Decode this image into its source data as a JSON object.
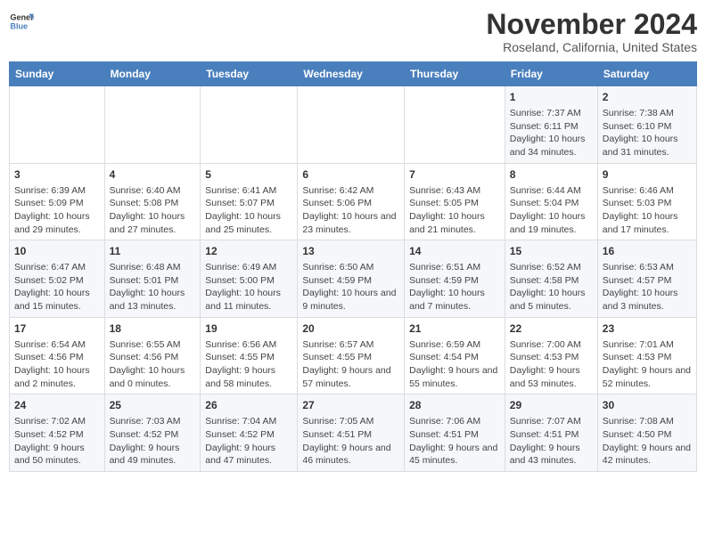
{
  "header": {
    "logo_line1": "General",
    "logo_line2": "Blue",
    "month": "November 2024",
    "location": "Roseland, California, United States"
  },
  "days_of_week": [
    "Sunday",
    "Monday",
    "Tuesday",
    "Wednesday",
    "Thursday",
    "Friday",
    "Saturday"
  ],
  "weeks": [
    [
      {
        "day": "",
        "info": ""
      },
      {
        "day": "",
        "info": ""
      },
      {
        "day": "",
        "info": ""
      },
      {
        "day": "",
        "info": ""
      },
      {
        "day": "",
        "info": ""
      },
      {
        "day": "1",
        "info": "Sunrise: 7:37 AM\nSunset: 6:11 PM\nDaylight: 10 hours and 34 minutes."
      },
      {
        "day": "2",
        "info": "Sunrise: 7:38 AM\nSunset: 6:10 PM\nDaylight: 10 hours and 31 minutes."
      }
    ],
    [
      {
        "day": "3",
        "info": "Sunrise: 6:39 AM\nSunset: 5:09 PM\nDaylight: 10 hours and 29 minutes."
      },
      {
        "day": "4",
        "info": "Sunrise: 6:40 AM\nSunset: 5:08 PM\nDaylight: 10 hours and 27 minutes."
      },
      {
        "day": "5",
        "info": "Sunrise: 6:41 AM\nSunset: 5:07 PM\nDaylight: 10 hours and 25 minutes."
      },
      {
        "day": "6",
        "info": "Sunrise: 6:42 AM\nSunset: 5:06 PM\nDaylight: 10 hours and 23 minutes."
      },
      {
        "day": "7",
        "info": "Sunrise: 6:43 AM\nSunset: 5:05 PM\nDaylight: 10 hours and 21 minutes."
      },
      {
        "day": "8",
        "info": "Sunrise: 6:44 AM\nSunset: 5:04 PM\nDaylight: 10 hours and 19 minutes."
      },
      {
        "day": "9",
        "info": "Sunrise: 6:46 AM\nSunset: 5:03 PM\nDaylight: 10 hours and 17 minutes."
      }
    ],
    [
      {
        "day": "10",
        "info": "Sunrise: 6:47 AM\nSunset: 5:02 PM\nDaylight: 10 hours and 15 minutes."
      },
      {
        "day": "11",
        "info": "Sunrise: 6:48 AM\nSunset: 5:01 PM\nDaylight: 10 hours and 13 minutes."
      },
      {
        "day": "12",
        "info": "Sunrise: 6:49 AM\nSunset: 5:00 PM\nDaylight: 10 hours and 11 minutes."
      },
      {
        "day": "13",
        "info": "Sunrise: 6:50 AM\nSunset: 4:59 PM\nDaylight: 10 hours and 9 minutes."
      },
      {
        "day": "14",
        "info": "Sunrise: 6:51 AM\nSunset: 4:59 PM\nDaylight: 10 hours and 7 minutes."
      },
      {
        "day": "15",
        "info": "Sunrise: 6:52 AM\nSunset: 4:58 PM\nDaylight: 10 hours and 5 minutes."
      },
      {
        "day": "16",
        "info": "Sunrise: 6:53 AM\nSunset: 4:57 PM\nDaylight: 10 hours and 3 minutes."
      }
    ],
    [
      {
        "day": "17",
        "info": "Sunrise: 6:54 AM\nSunset: 4:56 PM\nDaylight: 10 hours and 2 minutes."
      },
      {
        "day": "18",
        "info": "Sunrise: 6:55 AM\nSunset: 4:56 PM\nDaylight: 10 hours and 0 minutes."
      },
      {
        "day": "19",
        "info": "Sunrise: 6:56 AM\nSunset: 4:55 PM\nDaylight: 9 hours and 58 minutes."
      },
      {
        "day": "20",
        "info": "Sunrise: 6:57 AM\nSunset: 4:55 PM\nDaylight: 9 hours and 57 minutes."
      },
      {
        "day": "21",
        "info": "Sunrise: 6:59 AM\nSunset: 4:54 PM\nDaylight: 9 hours and 55 minutes."
      },
      {
        "day": "22",
        "info": "Sunrise: 7:00 AM\nSunset: 4:53 PM\nDaylight: 9 hours and 53 minutes."
      },
      {
        "day": "23",
        "info": "Sunrise: 7:01 AM\nSunset: 4:53 PM\nDaylight: 9 hours and 52 minutes."
      }
    ],
    [
      {
        "day": "24",
        "info": "Sunrise: 7:02 AM\nSunset: 4:52 PM\nDaylight: 9 hours and 50 minutes."
      },
      {
        "day": "25",
        "info": "Sunrise: 7:03 AM\nSunset: 4:52 PM\nDaylight: 9 hours and 49 minutes."
      },
      {
        "day": "26",
        "info": "Sunrise: 7:04 AM\nSunset: 4:52 PM\nDaylight: 9 hours and 47 minutes."
      },
      {
        "day": "27",
        "info": "Sunrise: 7:05 AM\nSunset: 4:51 PM\nDaylight: 9 hours and 46 minutes."
      },
      {
        "day": "28",
        "info": "Sunrise: 7:06 AM\nSunset: 4:51 PM\nDaylight: 9 hours and 45 minutes."
      },
      {
        "day": "29",
        "info": "Sunrise: 7:07 AM\nSunset: 4:51 PM\nDaylight: 9 hours and 43 minutes."
      },
      {
        "day": "30",
        "info": "Sunrise: 7:08 AM\nSunset: 4:50 PM\nDaylight: 9 hours and 42 minutes."
      }
    ]
  ]
}
